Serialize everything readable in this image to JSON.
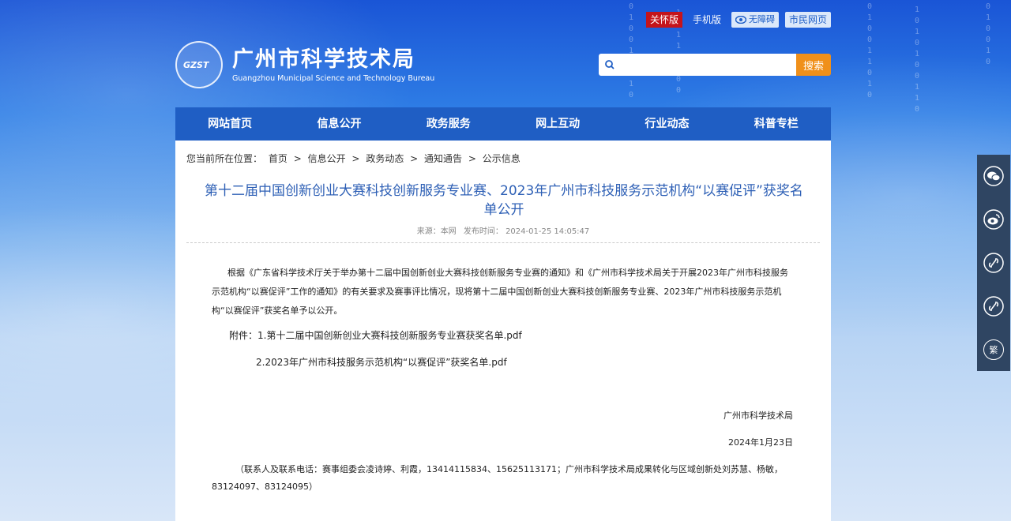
{
  "top_links": {
    "care": "关怀版",
    "mobile": "手机版",
    "accessibility": "无障碍",
    "citizen": "市民网页"
  },
  "logo": {
    "mark": "GZST",
    "title_cn": "广州市科学技术局",
    "title_en": "Guangzhou Municipal Science and Technology Bureau"
  },
  "search": {
    "placeholder": "",
    "button": "搜索"
  },
  "nav": [
    "网站首页",
    "信息公开",
    "政务服务",
    "网上互动",
    "行业动态",
    "科普专栏"
  ],
  "breadcrumb": {
    "prefix": "您当前所在位置：",
    "items": [
      "首页",
      "信息公开",
      "政务动态",
      "通知通告",
      "公示信息"
    ],
    "sep": ">"
  },
  "article": {
    "title": "第十二届中国创新创业大赛科技创新服务专业赛、2023年广州市科技服务示范机构“以赛促评”获奖名单公开",
    "source": "来源：本网",
    "publish": "发布时间：  2024-01-25 14:05:47",
    "paragraph": "根据《广东省科学技术厅关于举办第十二届中国创新创业大赛科技创新服务专业赛的通知》和《广州市科学技术局关于开展2023年广州市科技服务示范机构“以赛促评”工作的通知》的有关要求及赛事评比情况，现将第十二届中国创新创业大赛科技创新服务专业赛、2023年广州市科技服务示范机构“以赛促评”获奖名单予以公开。",
    "attachment_1": "附件：1.第十二届中国创新创业大赛科技创新服务专业赛获奖名单.pdf",
    "attachment_2": "2.2023年广州市科技服务示范机构“以赛促评”获奖名单.pdf",
    "signature_org": "广州市科学技术局",
    "signature_date": "2024年1月23日",
    "contact": "（联系人及联系电话：赛事组委会凌诗婷、利霞，13414115834、15625113171；广州市科学技术局成果转化与区域创新处刘苏慧、杨敏，83124097、83124095）"
  },
  "share": {
    "fan": "繁"
  }
}
